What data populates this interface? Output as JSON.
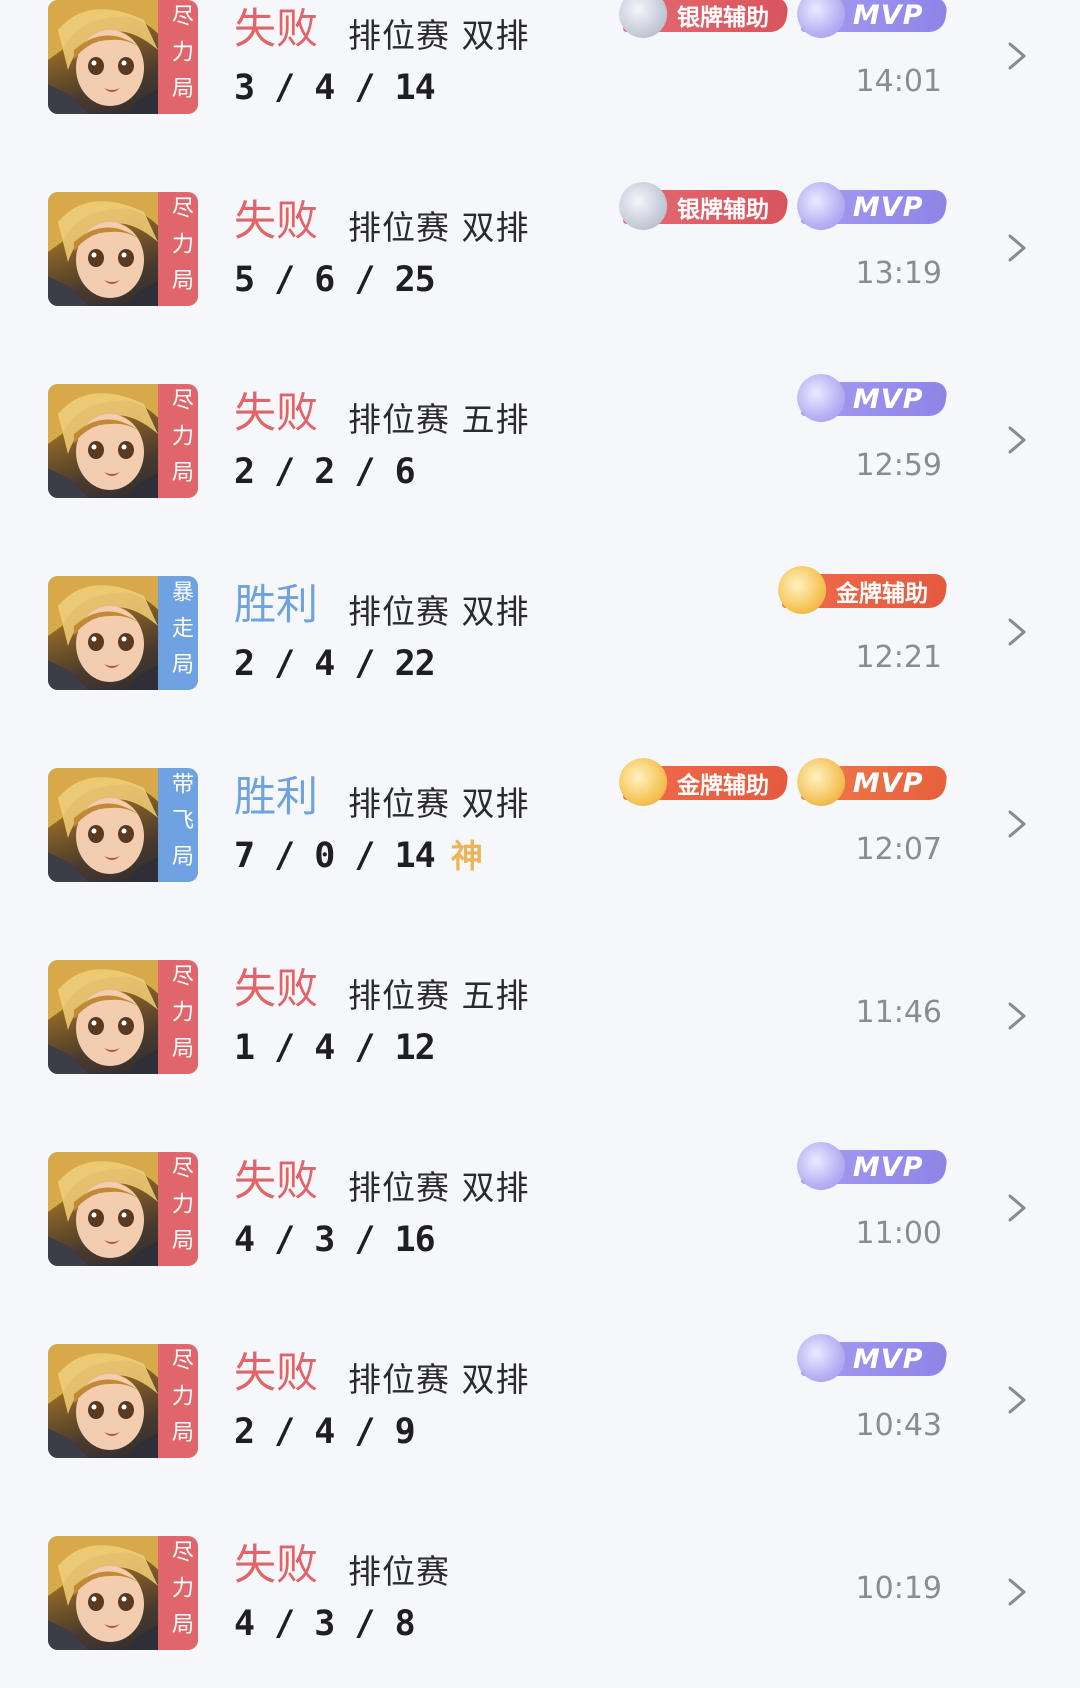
{
  "matches": [
    {
      "tag": "尽力局",
      "tag_type": "lose",
      "result": "失败",
      "result_type": "lose",
      "mode": "排位赛 双排",
      "kda": "3/4/14",
      "god": "",
      "badges": [
        {
          "type": "silver",
          "label": "银牌辅助"
        },
        {
          "type": "mvp-purple",
          "label": "MVP"
        }
      ],
      "time": "14:01"
    },
    {
      "tag": "尽力局",
      "tag_type": "lose",
      "result": "失败",
      "result_type": "lose",
      "mode": "排位赛 双排",
      "kda": "5/6/25",
      "god": "",
      "badges": [
        {
          "type": "silver",
          "label": "银牌辅助"
        },
        {
          "type": "mvp-purple",
          "label": "MVP"
        }
      ],
      "time": "13:19"
    },
    {
      "tag": "尽力局",
      "tag_type": "lose",
      "result": "失败",
      "result_type": "lose",
      "mode": "排位赛 五排",
      "kda": "2/2/6",
      "god": "",
      "badges": [
        {
          "type": "mvp-purple",
          "label": "MVP"
        }
      ],
      "time": "12:59"
    },
    {
      "tag": "暴走局",
      "tag_type": "win",
      "result": "胜利",
      "result_type": "win",
      "mode": "排位赛 双排",
      "kda": "2/4/22",
      "god": "",
      "badges": [
        {
          "type": "gold",
          "label": "金牌辅助"
        }
      ],
      "time": "12:21"
    },
    {
      "tag": "带飞局",
      "tag_type": "win",
      "result": "胜利",
      "result_type": "win",
      "mode": "排位赛 双排",
      "kda": "7/0/14",
      "god": "神",
      "badges": [
        {
          "type": "gold",
          "label": "金牌辅助"
        },
        {
          "type": "mvp-gold",
          "label": "MVP"
        }
      ],
      "time": "12:07"
    },
    {
      "tag": "尽力局",
      "tag_type": "lose",
      "result": "失败",
      "result_type": "lose",
      "mode": "排位赛 五排",
      "kda": "1/4/12",
      "god": "",
      "badges": [],
      "time": "11:46"
    },
    {
      "tag": "尽力局",
      "tag_type": "lose",
      "result": "失败",
      "result_type": "lose",
      "mode": "排位赛 双排",
      "kda": "4/3/16",
      "god": "",
      "badges": [
        {
          "type": "mvp-purple",
          "label": "MVP"
        }
      ],
      "time": "11:00"
    },
    {
      "tag": "尽力局",
      "tag_type": "lose",
      "result": "失败",
      "result_type": "lose",
      "mode": "排位赛 双排",
      "kda": "2/4/9",
      "god": "",
      "badges": [
        {
          "type": "mvp-purple",
          "label": "MVP"
        }
      ],
      "time": "10:43"
    },
    {
      "tag": "尽力局",
      "tag_type": "lose",
      "result": "失败",
      "result_type": "lose",
      "mode": "排位赛",
      "kda": "4/3/8",
      "god": "",
      "badges": [],
      "time": "10:19"
    }
  ],
  "icons": {
    "hero": "hero-avatar",
    "chevron": "chevron-right-icon"
  },
  "colors": {
    "lose": "#e06468",
    "win": "#6ea3df",
    "background": "#f6f7fb",
    "time": "#8c8c8c"
  }
}
